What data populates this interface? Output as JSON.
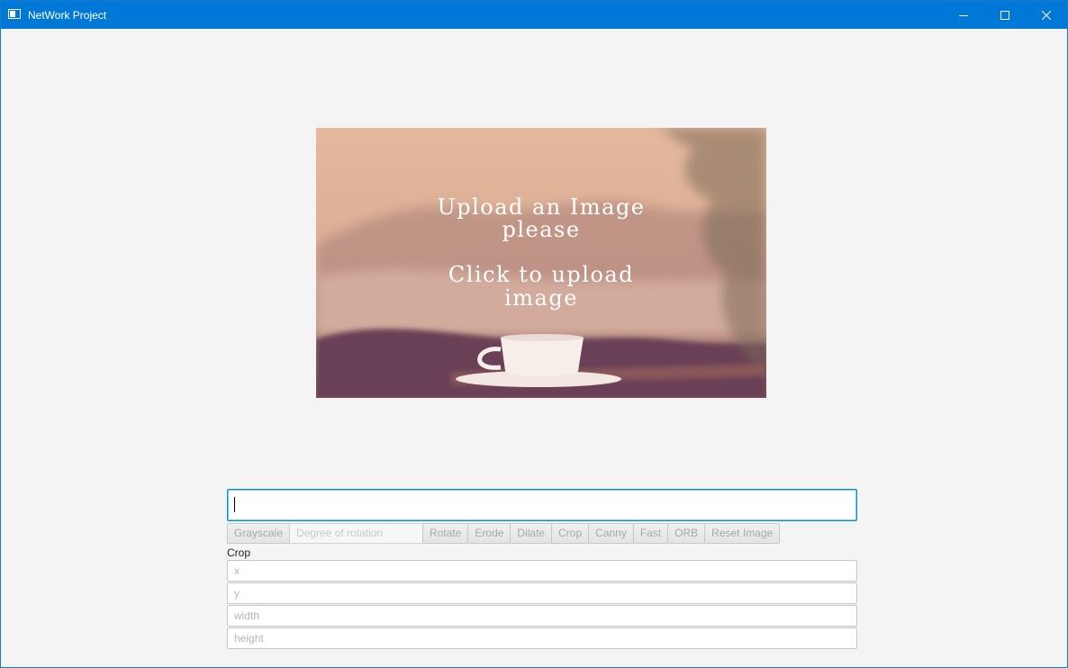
{
  "window": {
    "title": "NetWork Project",
    "controls": {
      "minimize": "minimize-icon",
      "maximize": "maximize-icon",
      "close": "close-icon"
    }
  },
  "upload": {
    "line1": "Upload an Image",
    "line2": "please",
    "line3": "Click to upload",
    "line4": "image"
  },
  "main_input": {
    "value": ""
  },
  "toolbar": {
    "grayscale": "Grayscale",
    "rotation_placeholder": "Degree of rotation",
    "rotate": "Rotate",
    "erode": "Erode",
    "dilate": "Dilate",
    "crop": "Crop",
    "canny": "Canny",
    "fast": "Fast",
    "orb": "ORB",
    "reset": "Reset Image"
  },
  "crop": {
    "label": "Crop",
    "x_placeholder": "x",
    "y_placeholder": "y",
    "width_placeholder": "width",
    "height_placeholder": "height"
  },
  "colors": {
    "titlebar": "#0078d7",
    "background": "#f4f4f4",
    "focus_border": "#0096c9"
  }
}
